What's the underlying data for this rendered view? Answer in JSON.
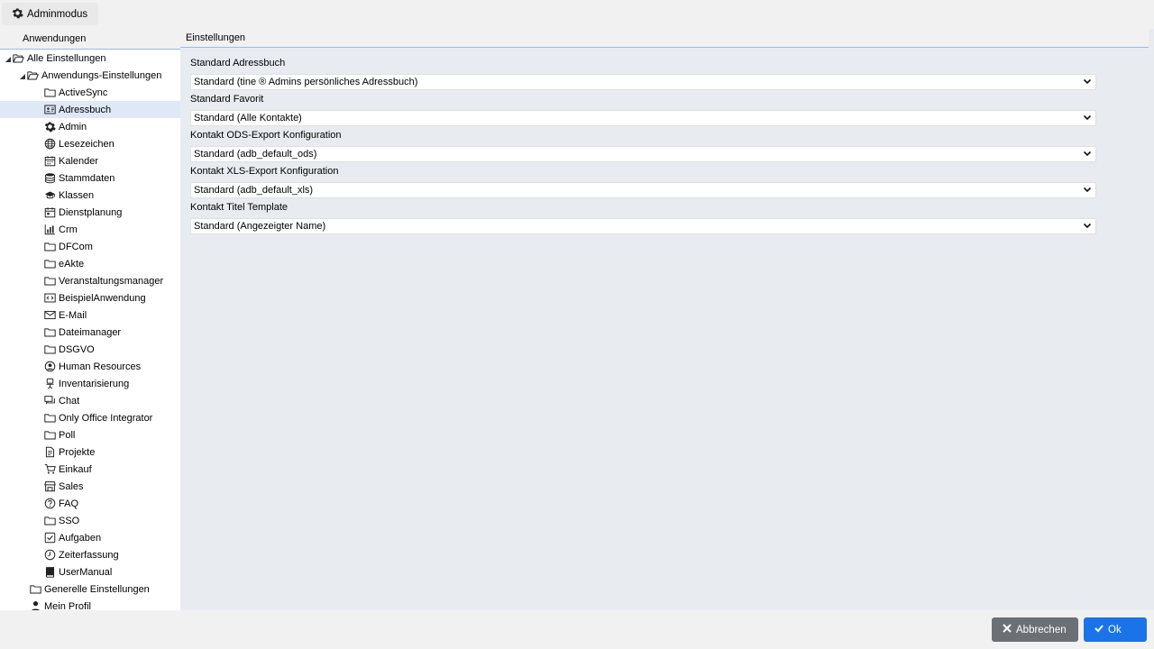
{
  "topbar": {
    "admin_mode_label": "Adminmodus"
  },
  "left": {
    "header": "Anwendungen",
    "root": {
      "label": "Alle Einstellungen",
      "icon": "folder-open-icon"
    },
    "app_settings": {
      "label": "Anwendungs-Einstellungen",
      "icon": "folder-open-icon"
    },
    "apps": [
      {
        "label": "ActiveSync",
        "icon": "folder-icon"
      },
      {
        "label": "Adressbuch",
        "icon": "address-card-icon",
        "selected": true
      },
      {
        "label": "Admin",
        "icon": "gear-icon"
      },
      {
        "label": "Lesezeichen",
        "icon": "globe-icon"
      },
      {
        "label": "Kalender",
        "icon": "calendar-icon"
      },
      {
        "label": "Stammdaten",
        "icon": "database-icon"
      },
      {
        "label": "Klassen",
        "icon": "graduation-cap-icon"
      },
      {
        "label": "Dienstplanung",
        "icon": "calendar-grid-icon"
      },
      {
        "label": "Crm",
        "icon": "bar-chart-icon"
      },
      {
        "label": "DFCom",
        "icon": "folder-icon"
      },
      {
        "label": "eAkte",
        "icon": "folder-icon"
      },
      {
        "label": "Veranstaltungsmanager",
        "icon": "folder-icon"
      },
      {
        "label": "BeispielAnwendung",
        "icon": "code-icon"
      },
      {
        "label": "E-Mail",
        "icon": "envelope-icon"
      },
      {
        "label": "Dateimanager",
        "icon": "folder-icon"
      },
      {
        "label": "DSGVO",
        "icon": "folder-icon"
      },
      {
        "label": "Human Resources",
        "icon": "user-circle-icon"
      },
      {
        "label": "Inventarisierung",
        "icon": "chair-icon"
      },
      {
        "label": "Chat",
        "icon": "chat-icon"
      },
      {
        "label": "Only Office Integrator",
        "icon": "folder-icon"
      },
      {
        "label": "Poll",
        "icon": "folder-icon"
      },
      {
        "label": "Projekte",
        "icon": "document-icon"
      },
      {
        "label": "Einkauf",
        "icon": "cart-icon"
      },
      {
        "label": "Sales",
        "icon": "store-icon"
      },
      {
        "label": "FAQ",
        "icon": "question-icon"
      },
      {
        "label": "SSO",
        "icon": "folder-icon"
      },
      {
        "label": "Aufgaben",
        "icon": "check-square-icon"
      },
      {
        "label": "Zeiterfassung",
        "icon": "clock-icon"
      },
      {
        "label": "UserManual",
        "icon": "book-icon"
      }
    ],
    "general": {
      "label": "Generelle Einstellungen",
      "icon": "folder-icon"
    },
    "profile": {
      "label": "Mein Profil",
      "icon": "user-icon"
    }
  },
  "right": {
    "header": "Einstellungen",
    "fields": [
      {
        "label": "Standard Adressbuch",
        "value": "Standard (tine ® Admins persönliches Adressbuch)"
      },
      {
        "label": "Standard Favorit",
        "value": "Standard (Alle Kontakte)"
      },
      {
        "label": "Kontakt ODS-Export Konfiguration",
        "value": "Standard (adb_default_ods)"
      },
      {
        "label": "Kontakt XLS-Export Konfiguration",
        "value": "Standard (adb_default_xls)"
      },
      {
        "label": "Kontakt Titel Template",
        "value": "Standard (Angezeigter Name)"
      }
    ]
  },
  "buttons": {
    "cancel": "Abbrechen",
    "ok": "Ok"
  },
  "colors": {
    "accent": "#1a73e8",
    "cancel": "#6b7075",
    "selected_row": "#dfe8f6",
    "panel_bg": "#e8ecf0"
  }
}
